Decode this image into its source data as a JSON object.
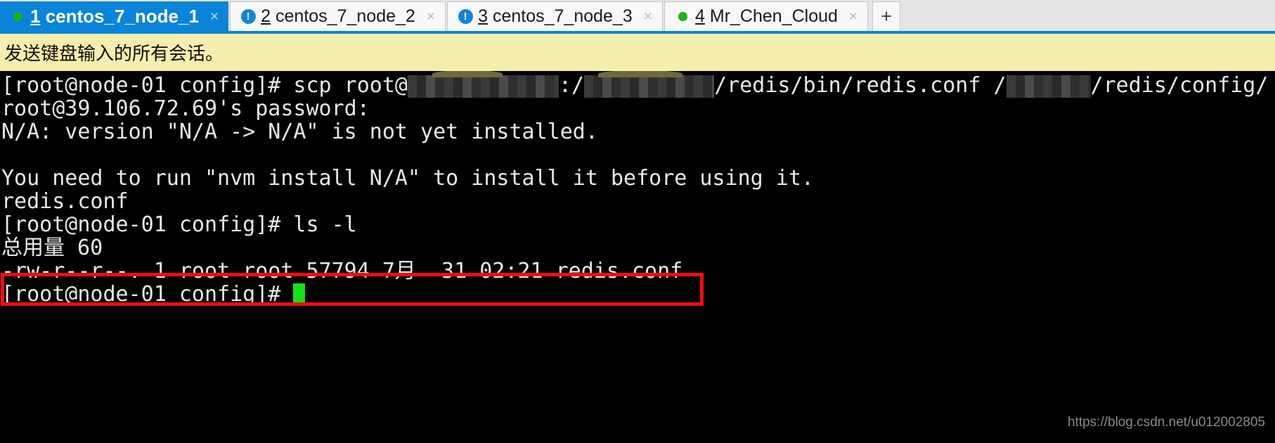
{
  "window": {
    "app": "terminal-session-manager",
    "accent_color": "#0a84d8",
    "notice_bg": "#f6eeae",
    "terminal_bg": "#000000",
    "terminal_fg": "#e8e8e8",
    "highlight_color": "#f20c0c",
    "cursor_color": "#16e016"
  },
  "tabs": [
    {
      "number": "1",
      "label": " centos_7_node_1",
      "status": "connected",
      "icon": "green-dot-icon",
      "active": true,
      "close_label": "×"
    },
    {
      "number": "2",
      "label": " centos_7_node_2",
      "status": "alert",
      "icon": "blue-exclamation-icon",
      "active": false,
      "close_label": "×"
    },
    {
      "number": "3",
      "label": " centos_7_node_3",
      "status": "alert",
      "icon": "blue-exclamation-icon",
      "active": false,
      "close_label": "×"
    },
    {
      "number": "4",
      "label": " Mr_Chen_Cloud",
      "status": "connected",
      "icon": "green-dot-icon",
      "active": false,
      "close_label": "×"
    }
  ],
  "new_tab": {
    "label": "+"
  },
  "notice": {
    "text": "发送键盘输入的所有会话。"
  },
  "terminal": {
    "lines": [
      {
        "id": "cmd-scp",
        "segments": [
          {
            "type": "text",
            "value": "[root@node-01 config]# scp root@"
          },
          {
            "type": "redact",
            "variant": "r1"
          },
          {
            "type": "text",
            "value": ":/"
          },
          {
            "type": "redact",
            "variant": "r2"
          },
          {
            "type": "text",
            "value": "/redis/bin/redis.conf /"
          },
          {
            "type": "redact",
            "variant": "r3"
          },
          {
            "type": "text",
            "value": "/redis/config/"
          }
        ]
      },
      {
        "id": "password-prompt",
        "text": "root@39.106.72.69's password:"
      },
      {
        "id": "nvm-not-installed",
        "text": "N/A: version \"N/A -> N/A\" is not yet installed."
      },
      {
        "id": "blank-1",
        "text": ""
      },
      {
        "id": "nvm-hint",
        "text": "You need to run \"nvm install N/A\" to install it before using it."
      },
      {
        "id": "scp-result",
        "text": "redis.conf"
      },
      {
        "id": "cmd-ls",
        "text": "[root@node-01 config]# ls -l"
      },
      {
        "id": "ls-total",
        "text": "总用量 60"
      },
      {
        "id": "ls-entry-redis-conf",
        "text": "-rw-r--r--. 1 root root 57794 7月  31 02:21 redis.conf"
      },
      {
        "id": "prompt-current",
        "text": "[root@node-01 config]# "
      }
    ],
    "highlighted_line_id": "ls-entry-redis-conf",
    "cursor": {
      "shape": "block",
      "line_id": "prompt-current"
    }
  },
  "watermark": {
    "text": "https://blog.csdn.net/u012002805"
  }
}
